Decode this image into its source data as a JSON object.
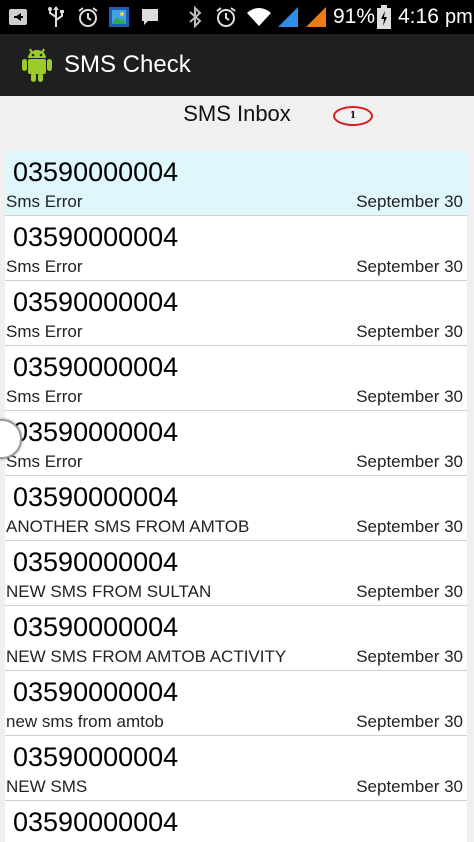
{
  "status_bar": {
    "battery": "91%",
    "time": "4:16",
    "time_suffix": "pm",
    "icons": [
      "back-arrow-icon",
      "usb-icon",
      "alarm-icon",
      "gallery-icon",
      "message-icon",
      "bluetooth-icon",
      "alarm-icon",
      "wifi-icon",
      "signal-icon",
      "signal-icon",
      "battery-charging-icon"
    ]
  },
  "action_bar": {
    "title": "SMS Check",
    "icon": "android-icon"
  },
  "inbox": {
    "title": "SMS Inbox",
    "badge": "1"
  },
  "messages": [
    {
      "number": "03590000004",
      "text": "Sms Error",
      "date": "September 30",
      "selected": true
    },
    {
      "number": "03590000004",
      "text": "Sms Error",
      "date": "September 30"
    },
    {
      "number": "03590000004",
      "text": "Sms Error",
      "date": "September 30"
    },
    {
      "number": "03590000004",
      "text": "Sms Error",
      "date": "September 30"
    },
    {
      "number": "03590000004",
      "text": "Sms Error",
      "date": "September 30"
    },
    {
      "number": "03590000004",
      "text": "ANOTHER SMS FROM AMTOB",
      "date": "September 30"
    },
    {
      "number": "03590000004",
      "text": "NEW SMS FROM SULTAN",
      "date": "September 30"
    },
    {
      "number": "03590000004",
      "text": "NEW SMS FROM AMTOB ACTIVITY",
      "date": "September 30"
    },
    {
      "number": "03590000004",
      "text": "new sms from amtob",
      "date": "September 30"
    },
    {
      "number": "03590000004",
      "text": "NEW SMS",
      "date": "September 30"
    },
    {
      "number": "03590000004",
      "text": "",
      "date": ""
    }
  ],
  "colors": {
    "status_bar": "#000000",
    "action_bar": "#1f1f1f",
    "content_bg": "#f0f0f0",
    "selected_row": "#dff6fa",
    "badge_ring": "#d81f1f",
    "signal_accent": "#2f8ee6",
    "signal_accent_2": "#f07b12",
    "android_green": "#9acb2a"
  }
}
